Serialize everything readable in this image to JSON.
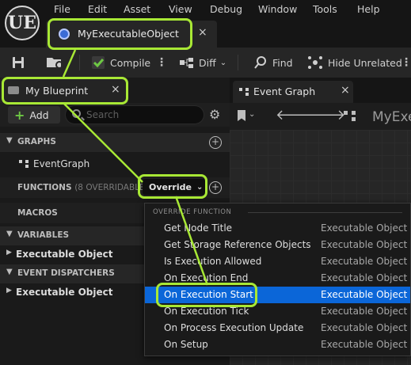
{
  "menubar": {
    "logo": "UE",
    "items": [
      "File",
      "Edit",
      "Asset",
      "View",
      "Debug",
      "Window",
      "Tools",
      "Help"
    ]
  },
  "document_tab": {
    "title": "MyExecutableObject",
    "close": "×",
    "icon": "blueprint-asset-icon"
  },
  "toolbar": {
    "compile_label": "Compile",
    "diff_label": "Diff",
    "find_label": "Find",
    "hide_unrelated_label": "Hide Unrelated"
  },
  "my_blueprint": {
    "tab_title": "My Blueprint",
    "add_label": "Add",
    "search_placeholder": "Search",
    "sections": {
      "graphs": "GRAPHS",
      "graph_item": "EventGraph",
      "functions": "FUNCTIONS",
      "functions_sub": "(8 OVERRIDABLE)",
      "macros": "MACROS",
      "variables": "VARIABLES",
      "variable_item": "Executable Object",
      "event_dispatchers": "EVENT DISPATCHERS",
      "dispatcher_item": "Executable Object"
    },
    "override_label": "Override"
  },
  "graph_panel": {
    "tab_title": "Event Graph",
    "breadcrumb": "MyExe"
  },
  "override_menu": {
    "header": "OVERRIDE FUNCTION",
    "items": [
      {
        "name": "Get Node Title",
        "owner": "Executable Object"
      },
      {
        "name": "Get Storage Reference Objects",
        "owner": "Executable Object"
      },
      {
        "name": "Is Execution Allowed",
        "owner": "Executable Object"
      },
      {
        "name": "On Execution End",
        "owner": "Executable Object"
      },
      {
        "name": "On Execution Start",
        "owner": "Executable Object",
        "selected": true
      },
      {
        "name": "On Execution Tick",
        "owner": "Executable Object"
      },
      {
        "name": "On Process Execution Update",
        "owner": "Executable Object"
      },
      {
        "name": "On Setup",
        "owner": "Executable Object"
      }
    ]
  },
  "colors": {
    "highlight": "#a8e835",
    "selection": "#0b66d8",
    "add_plus": "#6ec844"
  }
}
